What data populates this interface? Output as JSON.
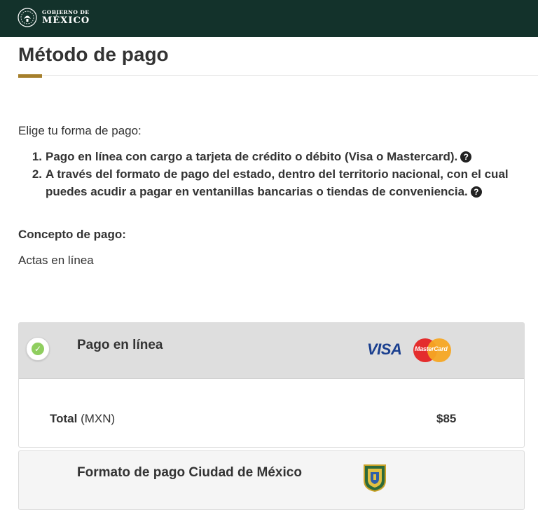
{
  "header": {
    "brand_line1": "GOBIERNO DE",
    "brand_line2": "MÉXICO",
    "background": "#13322b"
  },
  "page": {
    "title": "Método de pago",
    "accent_color": "#a57f2c"
  },
  "intro": "Elige tu forma de pago:",
  "options": [
    {
      "number": "1.",
      "text": "Pago en línea con cargo a tarjeta de crédito o débito (Visa o Mastercard).",
      "icon": "question-circle-icon"
    },
    {
      "number": "2.",
      "text": "A través del formato de pago del estado, dentro del territorio nacional, con el cual puedes acudir a pagar en ventanillas bancarias o tiendas de conveniencia.",
      "icon": "question-circle-icon"
    }
  ],
  "concept": {
    "label": "Concepto de pago:",
    "value": "Actas en línea"
  },
  "online_payment": {
    "title": "Pago en línea",
    "selected": true,
    "visa_label": "VISA",
    "mastercard_label": "MasterCard",
    "total_label": "Total",
    "total_currency": "(MXN)",
    "total_value": "$85"
  },
  "format_payment": {
    "title": "Formato de pago Ciudad de México",
    "icon": "cdmx-shield-icon"
  }
}
